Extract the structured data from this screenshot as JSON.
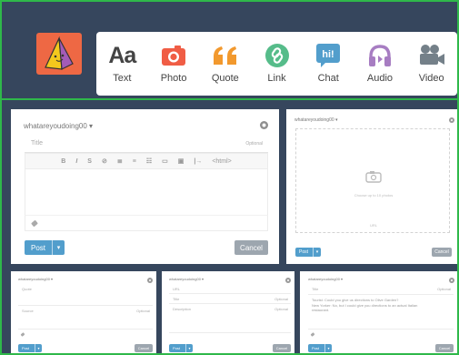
{
  "colors": {
    "dashboard_bg": "#36465d",
    "accent_green": "#2fb84a",
    "post_blue": "#529ecc",
    "cancel_gray": "#9da6af",
    "avatar_orange": "#ee6844"
  },
  "avatar": {
    "icon": "pyramid-icon"
  },
  "post_types": [
    {
      "label": "Text",
      "icon": "text-aa-icon",
      "glyph": "Aa",
      "color": "#444444"
    },
    {
      "label": "Photo",
      "icon": "camera-icon",
      "color": "#f05d45"
    },
    {
      "label": "Quote",
      "icon": "quote-icon",
      "glyph": "“",
      "color": "#f2992e"
    },
    {
      "label": "Link",
      "icon": "link-icon",
      "color": "#56bc8a"
    },
    {
      "label": "Chat",
      "icon": "chat-bubble-icon",
      "glyph": "hi!",
      "color": "#529ecc"
    },
    {
      "label": "Audio",
      "icon": "headphones-icon",
      "color": "#a77dc2"
    },
    {
      "label": "Video",
      "icon": "video-camera-icon",
      "color": "#748089"
    }
  ],
  "text_editor": {
    "blog_name": "whatareyoudoing00 ▾",
    "title_placeholder": "Title",
    "optional": "Optional",
    "toolbar": [
      "B",
      "I",
      "S",
      "⊘",
      "≣",
      "≡",
      "☷",
      "▭",
      "▣",
      "|→",
      "<html>"
    ],
    "post_label": "Post",
    "caret": "▾",
    "cancel_label": "Cancel"
  },
  "photo_editor": {
    "blog_name": "whatareyoudoing00 ▾",
    "drop_text": "Choose up to 10 photos",
    "url_text": "URL",
    "post_label": "Post",
    "caret": "▾",
    "cancel_label": "Cancel"
  },
  "quote_editor": {
    "blog_name": "whatareyoudoing00 ▾",
    "quote_placeholder": "Quote",
    "source_placeholder": "Source",
    "optional": "Optional",
    "post_label": "Post",
    "caret": "▾",
    "cancel_label": "Cancel"
  },
  "link_editor": {
    "blog_name": "whatareyoudoing00 ▾",
    "url_placeholder": "URL",
    "title_placeholder": "Title",
    "description_placeholder": "Description",
    "optional": "Optional",
    "post_label": "Post",
    "caret": "▾",
    "cancel_label": "Cancel"
  },
  "chat_editor": {
    "blog_name": "whatareyoudoing00 ▾",
    "title_placeholder": "Title",
    "optional": "Optional",
    "dialogue_line1": "Tourist: Could you give us directions to Olive Garden?",
    "dialogue_line2": "New Yorker: No, but I could give you directions to an actual Italian restaurant.",
    "post_label": "Post",
    "caret": "▾",
    "cancel_label": "Cancel"
  }
}
